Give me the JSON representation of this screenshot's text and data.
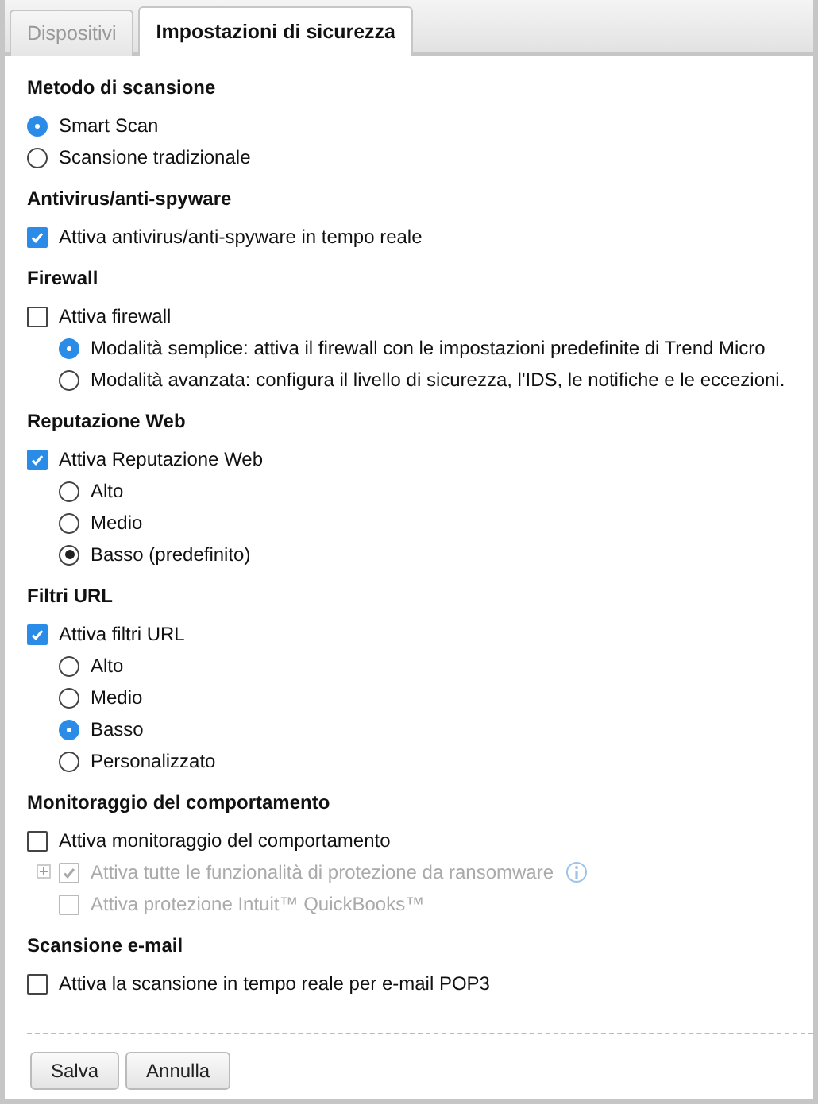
{
  "tabs": [
    {
      "label": "Dispositivi",
      "selected": false
    },
    {
      "label": "Impostazioni di sicurezza",
      "selected": true
    }
  ],
  "sections": [
    {
      "title": "Metodo di scansione",
      "items": [
        {
          "kind": "radio",
          "label": "Smart Scan",
          "selected": true,
          "disabled": false
        },
        {
          "kind": "radio",
          "label": "Scansione tradizionale",
          "selected": false,
          "disabled": false
        }
      ]
    },
    {
      "title": "Antivirus/anti-spyware",
      "items": [
        {
          "kind": "checkbox",
          "label": "Attiva antivirus/anti-spyware in tempo reale",
          "checked": true,
          "disabled": false
        }
      ]
    },
    {
      "title": "Firewall",
      "items": [
        {
          "kind": "checkbox",
          "label": "Attiva firewall",
          "checked": false,
          "disabled": false,
          "children": [
            {
              "kind": "radio",
              "label": "Modalità semplice: attiva il firewall con le impostazioni predefinite di Trend Micro",
              "selected": true,
              "disabled": false
            },
            {
              "kind": "radio",
              "label": "Modalità avanzata: configura il livello di sicurezza, l'IDS, le notifiche e le eccezioni.",
              "selected": false,
              "disabled": false
            }
          ]
        }
      ]
    },
    {
      "title": "Reputazione Web",
      "items": [
        {
          "kind": "checkbox",
          "label": "Attiva Reputazione Web",
          "checked": true,
          "disabled": false,
          "children": [
            {
              "kind": "radio",
              "label": "Alto",
              "selected": false,
              "disabled": false
            },
            {
              "kind": "radio",
              "label": "Medio",
              "selected": false,
              "disabled": false
            },
            {
              "kind": "radio",
              "label": "Basso (predefinito)",
              "selected": true,
              "focused": true,
              "disabled": false
            }
          ]
        }
      ]
    },
    {
      "title": "Filtri URL",
      "items": [
        {
          "kind": "checkbox",
          "label": "Attiva filtri URL",
          "checked": true,
          "disabled": false,
          "children": [
            {
              "kind": "radio",
              "label": "Alto",
              "selected": false,
              "disabled": false
            },
            {
              "kind": "radio",
              "label": "Medio",
              "selected": false,
              "disabled": false
            },
            {
              "kind": "radio",
              "label": "Basso",
              "selected": true,
              "disabled": false
            },
            {
              "kind": "radio",
              "label": "Personalizzato",
              "selected": false,
              "disabled": false
            }
          ]
        }
      ]
    },
    {
      "title": "Monitoraggio del comportamento",
      "items": [
        {
          "kind": "checkbox",
          "label": "Attiva monitoraggio del comportamento",
          "checked": false,
          "disabled": false,
          "children": [
            {
              "kind": "checkbox",
              "label": "Attiva tutte le funzionalità di protezione da ransomware",
              "checked": true,
              "disabled": true,
              "expandable": true,
              "expanded": false,
              "info": true
            },
            {
              "kind": "checkbox",
              "label": "Attiva protezione Intuit™ QuickBooks™",
              "checked": false,
              "disabled": true
            }
          ]
        }
      ]
    },
    {
      "title": "Scansione e-mail",
      "items": [
        {
          "kind": "checkbox",
          "label": "Attiva la scansione in tempo reale per e-mail POP3",
          "checked": false,
          "disabled": false
        }
      ]
    }
  ],
  "buttons": [
    {
      "label": "Salva"
    },
    {
      "label": "Annulla"
    }
  ]
}
